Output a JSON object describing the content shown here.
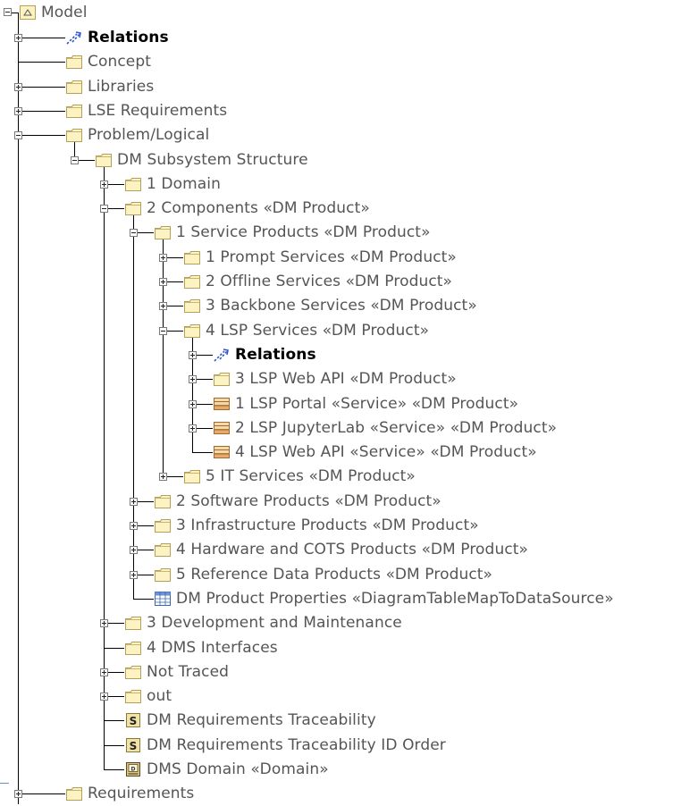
{
  "tree": {
    "root_label": "Model",
    "rows": [
      {
        "label": "Relations",
        "depth": 1,
        "expander": "plus",
        "icon": "relations-icon",
        "bold": true
      },
      {
        "label": "Concept",
        "depth": 1,
        "expander": "none",
        "icon": "folder-icon"
      },
      {
        "label": "Libraries",
        "depth": 1,
        "expander": "plus",
        "icon": "folder-icon"
      },
      {
        "label": "LSE Requirements",
        "depth": 1,
        "expander": "plus",
        "icon": "folder-icon"
      },
      {
        "label": "Problem/Logical",
        "depth": 1,
        "expander": "minus",
        "icon": "folder-icon"
      },
      {
        "label": "DM Subsystem Structure",
        "depth": 2,
        "expander": "minus",
        "icon": "folder-icon"
      },
      {
        "label": "1 Domain",
        "depth": 3,
        "expander": "plus",
        "icon": "folder-icon"
      },
      {
        "label": "2 Components «DM Product»",
        "depth": 3,
        "expander": "minus",
        "icon": "folder-icon"
      },
      {
        "label": "1 Service Products «DM Product»",
        "depth": 4,
        "expander": "minus",
        "icon": "folder-icon"
      },
      {
        "label": "1 Prompt Services «DM Product»",
        "depth": 5,
        "expander": "plus",
        "icon": "folder-icon"
      },
      {
        "label": "2 Offline Services «DM Product»",
        "depth": 5,
        "expander": "plus",
        "icon": "folder-icon"
      },
      {
        "label": "3 Backbone Services «DM Product»",
        "depth": 5,
        "expander": "plus",
        "icon": "folder-icon"
      },
      {
        "label": "4 LSP Services «DM Product»",
        "depth": 5,
        "expander": "minus",
        "icon": "folder-icon"
      },
      {
        "label": "Relations",
        "depth": 6,
        "expander": "plus",
        "icon": "relations-icon",
        "bold": true
      },
      {
        "label": "3 LSP Web API «DM Product»",
        "depth": 6,
        "expander": "plus",
        "icon": "folder-icon"
      },
      {
        "label": "1 LSP Portal «Service» «DM Product»",
        "depth": 6,
        "expander": "plus",
        "icon": "service-icon"
      },
      {
        "label": "2 LSP JupyterLab «Service» «DM Product»",
        "depth": 6,
        "expander": "plus",
        "icon": "service-icon"
      },
      {
        "label": "4 LSP Web API «Service» «DM Product»",
        "depth": 6,
        "expander": "none",
        "icon": "service-icon"
      },
      {
        "label": "5 IT Services «DM Product»",
        "depth": 5,
        "expander": "plus",
        "icon": "folder-icon"
      },
      {
        "label": "2 Software Products «DM Product»",
        "depth": 4,
        "expander": "plus",
        "icon": "folder-icon"
      },
      {
        "label": "3 Infrastructure Products «DM Product»",
        "depth": 4,
        "expander": "plus",
        "icon": "folder-icon"
      },
      {
        "label": "4 Hardware and COTS Products «DM Product»",
        "depth": 4,
        "expander": "plus",
        "icon": "folder-icon"
      },
      {
        "label": "5 Reference Data Products «DM Product»",
        "depth": 4,
        "expander": "plus",
        "icon": "folder-icon"
      },
      {
        "label": "DM Product Properties «DiagramTableMapToDataSource»",
        "depth": 4,
        "expander": "none",
        "icon": "table-icon"
      },
      {
        "label": "3 Development and Maintenance",
        "depth": 3,
        "expander": "plus",
        "icon": "folder-icon"
      },
      {
        "label": "4 DMS Interfaces",
        "depth": 3,
        "expander": "none",
        "icon": "folder-icon"
      },
      {
        "label": "Not Traced",
        "depth": 3,
        "expander": "plus",
        "icon": "folder-icon"
      },
      {
        "label": "out",
        "depth": 3,
        "expander": "plus",
        "icon": "folder-icon"
      },
      {
        "label": "DM Requirements Traceability",
        "depth": 3,
        "expander": "none",
        "icon": "script-icon"
      },
      {
        "label": "DM Requirements Traceability ID Order",
        "depth": 3,
        "expander": "none",
        "icon": "script-icon"
      },
      {
        "label": "DMS Domain «Domain»",
        "depth": 3,
        "expander": "none",
        "icon": "domain-icon"
      },
      {
        "label": "Requirements",
        "depth": 1,
        "expander": "plus",
        "icon": "folder-icon"
      }
    ]
  },
  "colors": {
    "folder_fill": "#fdf3c2",
    "folder_stroke": "#b3a05a",
    "relations_blue": "#2b55c8",
    "text_gray": "#555555"
  }
}
